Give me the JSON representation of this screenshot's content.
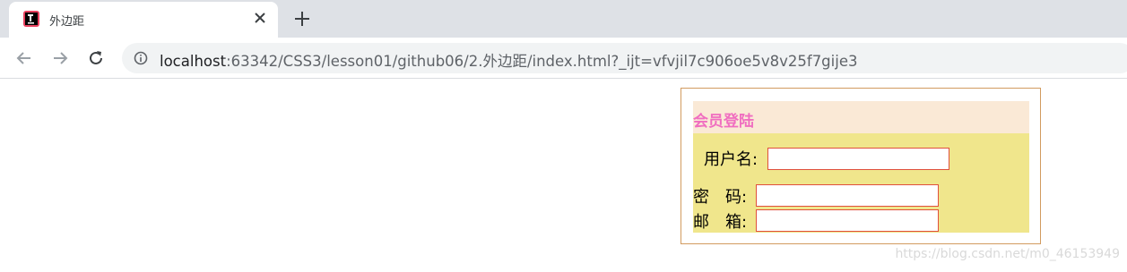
{
  "browser": {
    "tab": {
      "title": "外边距"
    },
    "address": {
      "host": "localhost",
      "path": ":63342/CSS3/lesson01/github06/2.外边距/index.html?_ijt=vfvjil7c906oe5v8v25f7gije3"
    }
  },
  "login": {
    "title": "会员登陆",
    "fields": [
      {
        "label": "用户名:",
        "value": ""
      },
      {
        "label": "密　码:",
        "value": ""
      },
      {
        "label": "邮　箱:",
        "value": ""
      }
    ]
  },
  "watermark": "https://blog.csdn.net/m0_46153949",
  "colors": {
    "box_border": "#d29b5f",
    "header_bg": "#fae9d6",
    "title_text": "#f06ec0",
    "body_bg": "#f0e68c",
    "input_border": "#e0503c"
  }
}
